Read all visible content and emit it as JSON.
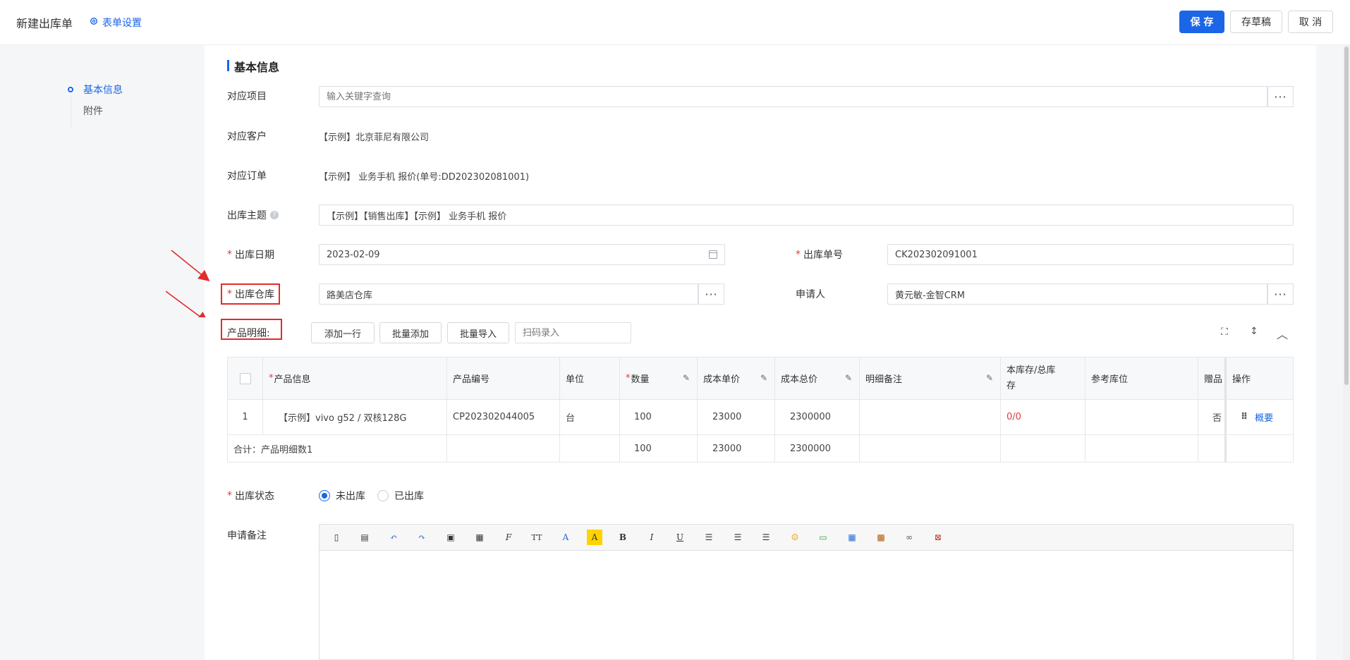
{
  "header": {
    "title": "新建出库单",
    "form_settings": "表单设置",
    "save": "保 存",
    "draft": "存草稿",
    "cancel": "取 消"
  },
  "sidenav": {
    "items": [
      {
        "label": "基本信息",
        "active": true
      },
      {
        "label": "附件",
        "active": false
      }
    ]
  },
  "section": {
    "title": "基本信息"
  },
  "form": {
    "project": {
      "label": "对应项目",
      "placeholder": "输入关键字查询"
    },
    "customer": {
      "label": "对应客户",
      "value": "【示例】北京菲尼有限公司"
    },
    "order": {
      "label": "对应订单",
      "value": "【示例】 业务手机 报价(单号:DD202302081001)"
    },
    "subject": {
      "label": "出库主题",
      "value": "【示例】【销售出库】【示例】 业务手机 报价"
    },
    "date": {
      "label": "出库日期",
      "value": "2023-02-09"
    },
    "number": {
      "label": "出库单号",
      "value": "CK202302091001"
    },
    "warehouse": {
      "label": "出库仓库",
      "value": "路美店仓库"
    },
    "applicant": {
      "label": "申请人",
      "value": "黄元敏-金智CRM"
    },
    "status": {
      "label": "出库状态",
      "options": [
        "未出库",
        "已出库"
      ],
      "selected": "未出库"
    },
    "remark": {
      "label": "申请备注"
    }
  },
  "products": {
    "label": "产品明细:",
    "add_row": "添加一行",
    "batch_add": "批量添加",
    "batch_import": "批量导入",
    "scan_placeholder": "扫码录入",
    "columns": [
      "产品信息",
      "产品编号",
      "单位",
      "数量",
      "成本单价",
      "成本总价",
      "明细备注",
      "本库存/总库存",
      "参考库位",
      "赠品",
      "操作"
    ],
    "rows": [
      {
        "index": "1",
        "info": "【示例】vivo g52 / 双核128G",
        "code": "CP202302044005",
        "unit": "台",
        "qty": "100",
        "unit_cost": "23000",
        "total_cost": "2300000",
        "note": "",
        "stock": "0/0",
        "location": "",
        "gift": "否",
        "op": "概要"
      }
    ],
    "summary": {
      "label": "合计：产品明细数1",
      "qty": "100",
      "unit_cost": "23000",
      "total_cost": "2300000"
    }
  },
  "colors": {
    "primary": "#1a66e6",
    "required": "#e03a3a",
    "annotation": "#e32b2b"
  }
}
